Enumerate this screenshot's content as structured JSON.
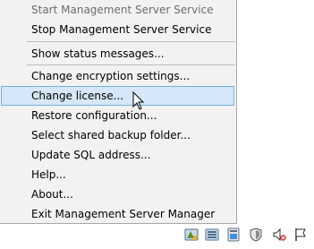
{
  "menu": {
    "items": [
      {
        "label": "Start Management Server Service",
        "enabled": false
      },
      {
        "label": "Stop Management Server Service",
        "enabled": true
      },
      {
        "label": "Show status messages...",
        "enabled": true
      },
      {
        "label": "Change encryption settings...",
        "enabled": true
      },
      {
        "label": "Change license...",
        "enabled": true,
        "highlighted": true
      },
      {
        "label": "Restore configuration...",
        "enabled": true
      },
      {
        "label": "Select shared backup folder...",
        "enabled": true
      },
      {
        "label": "Update SQL address...",
        "enabled": true
      },
      {
        "label": "Help...",
        "enabled": true
      },
      {
        "label": "About...",
        "enabled": true
      },
      {
        "label": "Exit Management Server Manager",
        "enabled": true
      }
    ]
  },
  "tray": {
    "icons": [
      "management-server-icon",
      "recording-server-icon",
      "event-server-icon",
      "shield-icon",
      "network-icon",
      "speaker-muted-icon",
      "flag-icon"
    ]
  },
  "colors": {
    "highlight_bg": "#d5e7f8",
    "highlight_border": "#7aaede",
    "menu_bg": "#f2f2f2"
  }
}
